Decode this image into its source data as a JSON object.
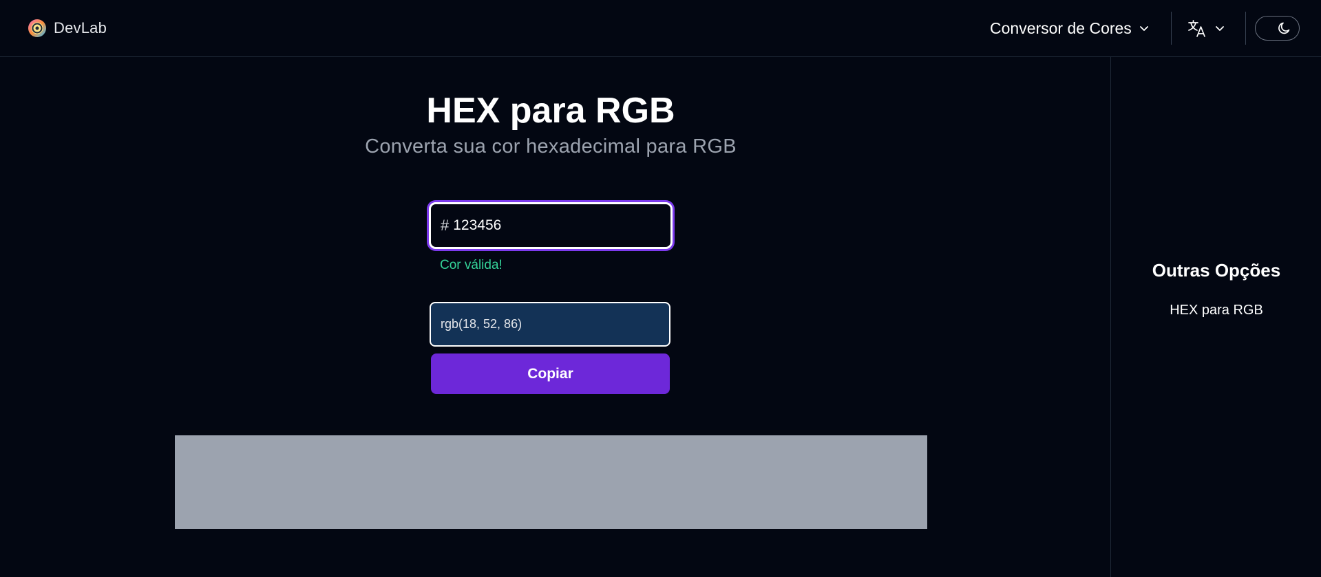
{
  "header": {
    "brand_name": "DevLab",
    "tool_menu_label": "Conversor de Cores",
    "language_icon": "translate-icon",
    "theme_icon": "moon-icon"
  },
  "main": {
    "title": "HEX para RGB",
    "subtitle": "Converta sua cor hexadecimal para RGB",
    "hex_prefix": "#",
    "hex_value": "123456",
    "validation_message": "Cor válida!",
    "rgb_value": "rgb(18, 52, 86)",
    "copy_label": "Copiar"
  },
  "sidebar": {
    "title": "Outras Opções",
    "items": [
      {
        "label": "HEX para RGB"
      }
    ]
  },
  "colors": {
    "background": "#030712",
    "accent": "#6d28d9",
    "focus_ring": "#7c3aed",
    "valid": "#34d399",
    "rgb_preview": "#133256",
    "ad_placeholder": "#9ca3af"
  }
}
